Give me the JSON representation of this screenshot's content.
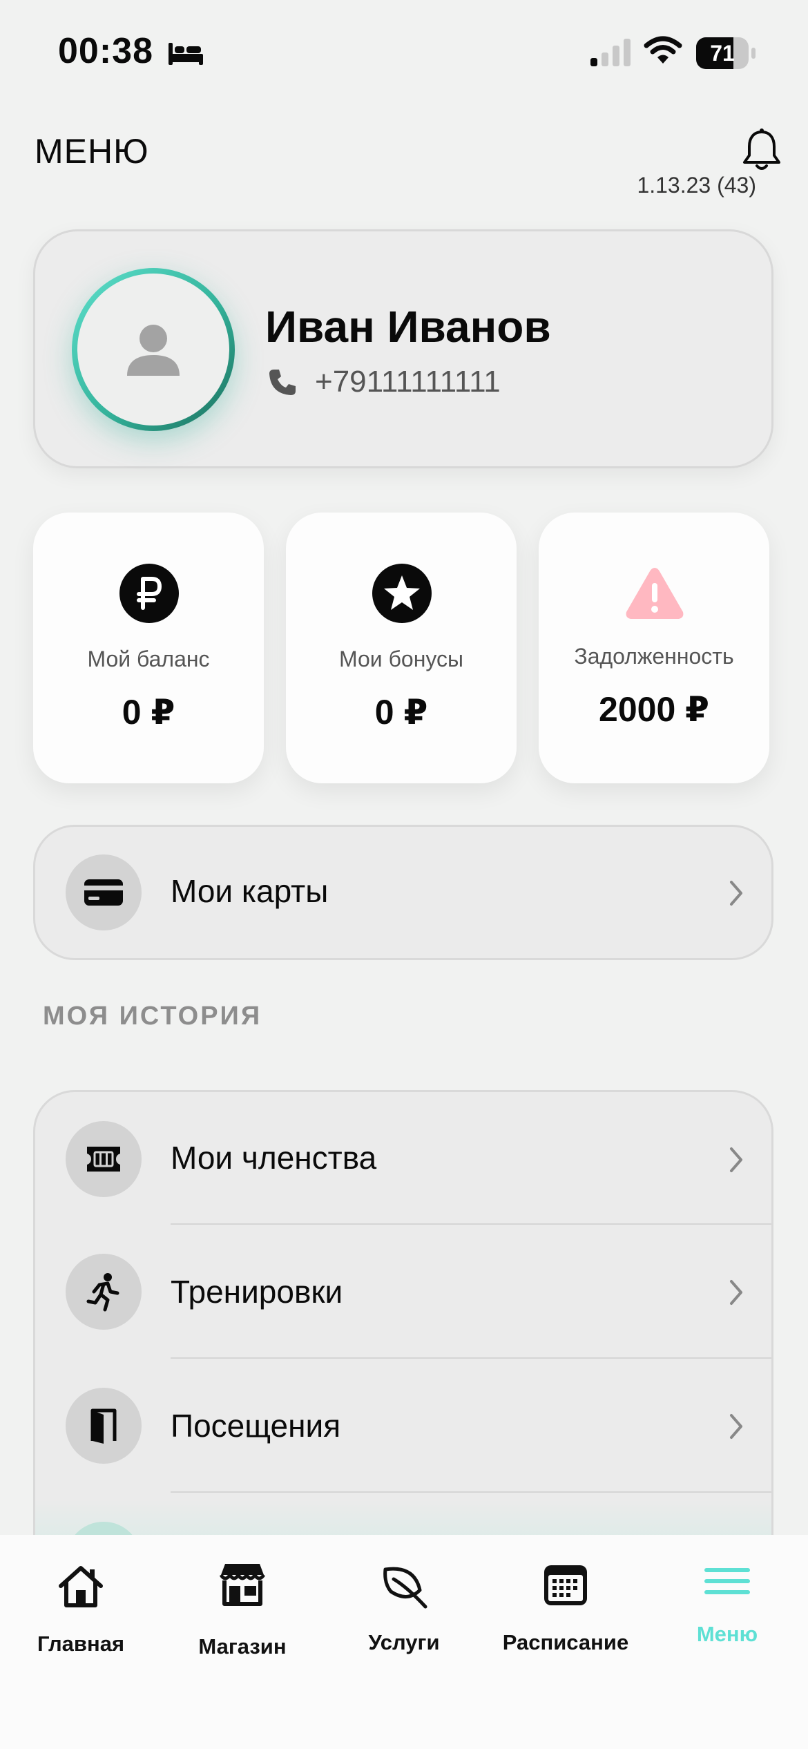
{
  "status_bar": {
    "time": "00:38",
    "battery": "71",
    "battery_level": 0.71
  },
  "header": {
    "title": "МЕНЮ",
    "version": "1.13.23 (43)"
  },
  "profile": {
    "name": "Иван Иванов",
    "phone": "+79111111111"
  },
  "stats": [
    {
      "label": "Мой баланс",
      "value": "0 ₽",
      "icon": "ruble-icon"
    },
    {
      "label": "Мои бонусы",
      "value": "0 ₽",
      "icon": "star-icon"
    },
    {
      "label": "Задолженность",
      "value": "2000 ₽",
      "icon": "warning-icon"
    }
  ],
  "cards_item": {
    "label": "Мои карты",
    "icon": "credit-card-icon"
  },
  "history": {
    "title": "МОЯ ИСТОРИЯ",
    "items": [
      {
        "label": "Мои членства",
        "icon": "ticket-icon"
      },
      {
        "label": "Тренировки",
        "icon": "running-icon"
      },
      {
        "label": "Посещения",
        "icon": "door-icon"
      }
    ]
  },
  "nav": {
    "items": [
      {
        "label": "Главная",
        "icon": "home-icon"
      },
      {
        "label": "Магазин",
        "icon": "store-icon"
      },
      {
        "label": "Услуги",
        "icon": "leaf-icon"
      },
      {
        "label": "Расписание",
        "icon": "calendar-icon"
      },
      {
        "label": "Меню",
        "icon": "menu-icon"
      }
    ],
    "active": "Меню"
  },
  "colors": {
    "accent": "#5ee0d4",
    "avatar_ring": "#34b39b",
    "warning": "#ffb8c1"
  }
}
